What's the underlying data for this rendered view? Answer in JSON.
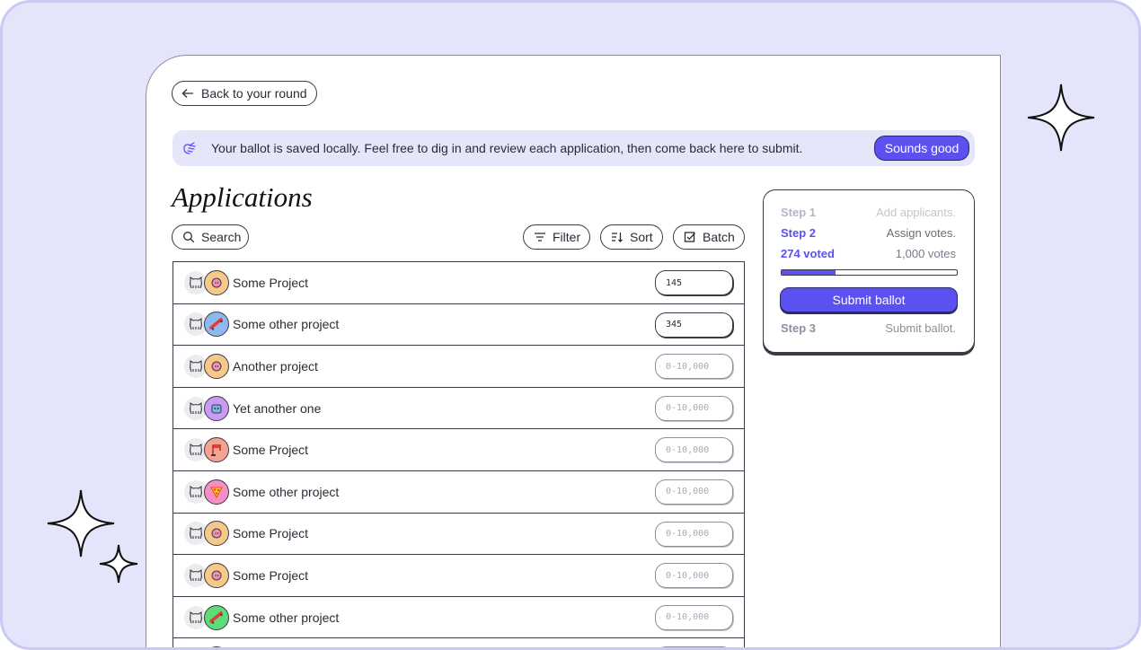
{
  "back_label": "Back to your round",
  "notice": {
    "text": "Your ballot is saved locally. Feel free to dig in and review each application, then come back here to submit.",
    "button": "Sounds good"
  },
  "title": "Applications",
  "toolbar": {
    "search": "Search",
    "filter": "Filter",
    "sort": "Sort",
    "batch": "Batch"
  },
  "input_placeholder": "0-10,000",
  "rows": [
    {
      "name": "Some Project",
      "value": "145",
      "avatar_color": "#f6c98a",
      "avatar_icon": "pig-icon"
    },
    {
      "name": "Some other project",
      "value": "345",
      "avatar_color": "#8fb7f0",
      "avatar_icon": "skateboard-icon"
    },
    {
      "name": "Another project",
      "value": "",
      "avatar_color": "#f6c98a",
      "avatar_icon": "pig-icon"
    },
    {
      "name": "Yet another one",
      "value": "",
      "avatar_color": "#c79cf2",
      "avatar_icon": "robot-icon"
    },
    {
      "name": "Some Project",
      "value": "",
      "avatar_color": "#f3a38f",
      "avatar_icon": "crane-icon"
    },
    {
      "name": "Some other project",
      "value": "",
      "avatar_color": "#f58ec5",
      "avatar_icon": "pizza-icon"
    },
    {
      "name": "Some Project",
      "value": "",
      "avatar_color": "#f6c98a",
      "avatar_icon": "pig-icon"
    },
    {
      "name": "Some Project",
      "value": "",
      "avatar_color": "#f6c98a",
      "avatar_icon": "pig-icon"
    },
    {
      "name": "Some other project",
      "value": "",
      "avatar_color": "#5fdc78",
      "avatar_icon": "skateboard-icon"
    },
    {
      "name": "",
      "value": "",
      "avatar_color": "#f6c98a",
      "avatar_icon": "pig-icon"
    }
  ],
  "steps": {
    "step1": {
      "label": "Step 1",
      "desc": "Add applicants."
    },
    "step2": {
      "label": "Step 2",
      "desc": "Assign votes."
    },
    "voted": {
      "label": "274 voted",
      "desc": "1,000 votes"
    },
    "progress": 0.31,
    "submit": "Submit ballot",
    "step3": {
      "label": "Step 3",
      "desc": "Submit ballot."
    }
  },
  "colors": {
    "accent": "#5b50f0",
    "background": "#e4e4fb",
    "notice_bg": "#e6e6fb"
  }
}
